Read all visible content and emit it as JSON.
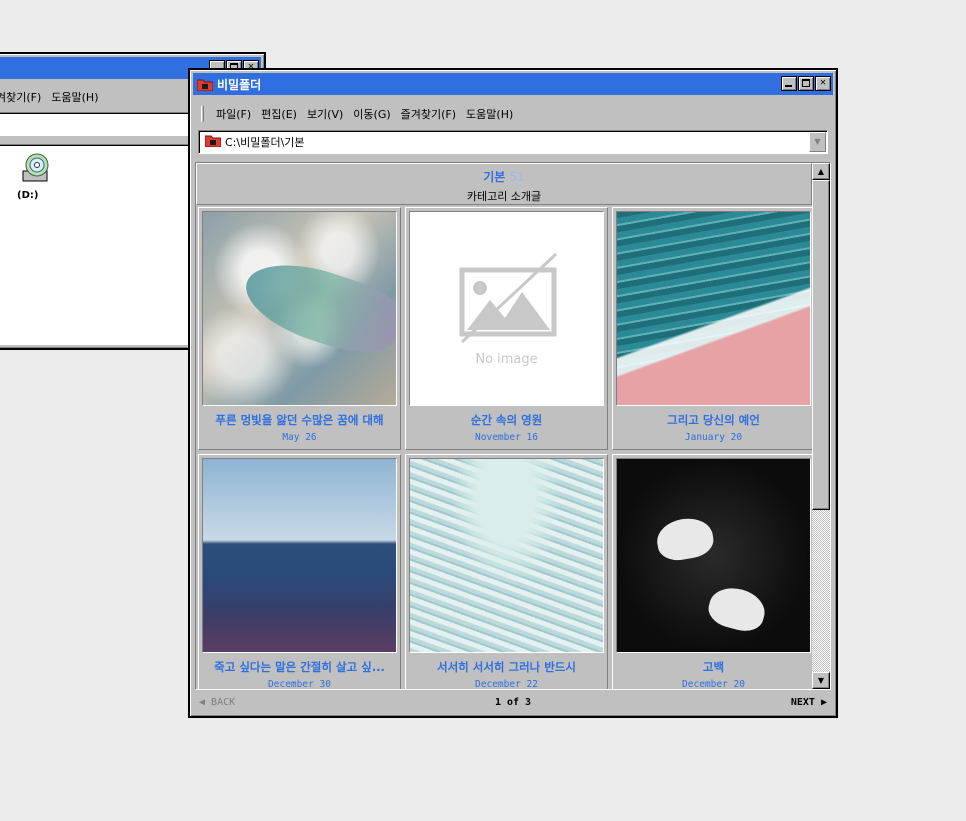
{
  "back_window": {
    "menu": [
      "겨찾기(F)",
      "도움말(H)"
    ],
    "drive_label": "(D:)"
  },
  "main_window": {
    "title": "비밀폴더",
    "menu": [
      "파일(F)",
      "편집(E)",
      "보기(V)",
      "이동(G)",
      "즐겨찾기(F)",
      "도움말(H)"
    ],
    "address": "C:\\비밀폴더\\기본",
    "category": {
      "title": "기본",
      "count": "51",
      "subtitle": "카테고리 소개글"
    },
    "posts": [
      {
        "title": "푸른 멍빛을 앓던 수많은 꿈에 대해",
        "date": "May 26",
        "thumb": "water-fish"
      },
      {
        "title": "순간 속의 영원",
        "date": "November 16",
        "thumb": "no-image",
        "placeholder": "No image"
      },
      {
        "title": "그리고 당신의 예언",
        "date": "January 20",
        "thumb": "pink-shore"
      },
      {
        "title": "죽고 싶다는 말은 간절히 살고 싶...",
        "date": "December 30",
        "thumb": "sea-horizon"
      },
      {
        "title": "서서히 서서히 그러나 반드시",
        "date": "December 22",
        "thumb": "sea-foam"
      },
      {
        "title": "고백",
        "date": "December 20",
        "thumb": "doves"
      }
    ],
    "pager": {
      "back": "BACK",
      "page": "1 of 3",
      "next": "NEXT"
    }
  },
  "colors": {
    "titlebar": "#2f6fe0",
    "link": "#2f6fe0",
    "chrome": "#c0c0c0",
    "desktop": "#ececec"
  }
}
